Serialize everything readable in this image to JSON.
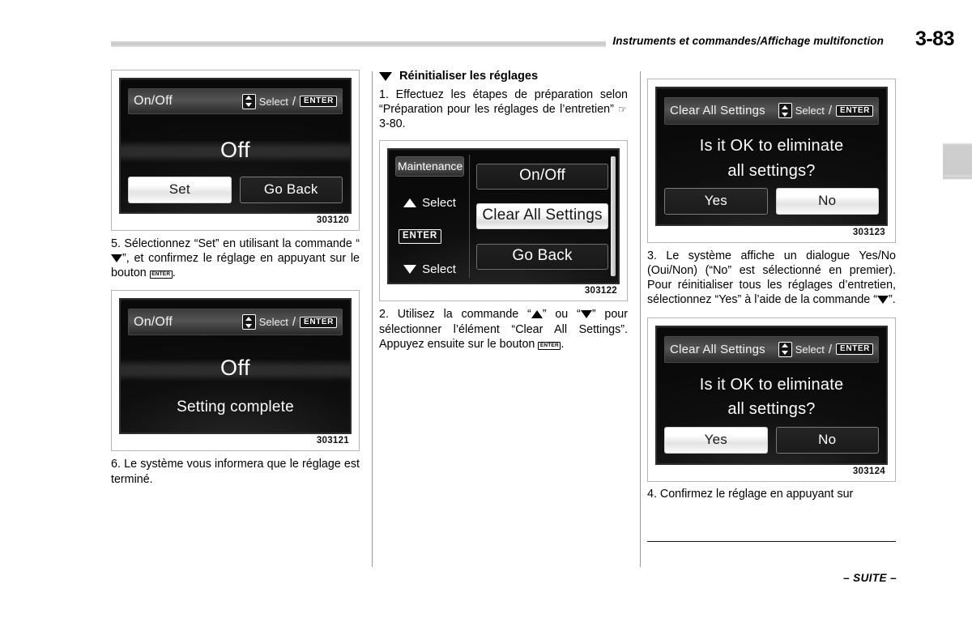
{
  "header": {
    "title": "Instruments et commandes/Affichage multifonction",
    "page_number": "3-83"
  },
  "footer": {
    "continued": "– SUITE –"
  },
  "columns": {
    "left": {
      "figures": [
        {
          "id": "303120",
          "screen": {
            "title": "On/Off",
            "select_label": "Select",
            "enter_label": "ENTER",
            "value": "Off",
            "buttons": [
              {
                "label": "Set",
                "selected": true
              },
              {
                "label": "Go Back",
                "selected": false
              }
            ]
          }
        },
        {
          "id": "303121",
          "screen": {
            "title": "On/Off",
            "select_label": "Select",
            "enter_label": "ENTER",
            "value": "Off",
            "message": "Setting complete"
          }
        }
      ],
      "steps": [
        {
          "text_a": "5. Sélectionnez “Set” en utilisant la commande “",
          "text_b": "”, et confirmez le réglage en appuyant sur le bouton ",
          "enter": "ENTER",
          "text_c": "."
        },
        {
          "text": "6. Le système vous informera que le réglage est terminé."
        }
      ]
    },
    "middle": {
      "section_heading": "Réinitialiser les réglages",
      "step1": {
        "text_a": "1. Effectuez les étapes de préparation selon “Préparation pour les réglages de l’entretien” ",
        "ref_icon": "☞",
        "ref": "3-80."
      },
      "figure": {
        "id": "303122",
        "screen": {
          "side": {
            "title": "Maintenance",
            "select_up": "Select",
            "enter_label": "ENTER",
            "select_down": "Select"
          },
          "items": [
            {
              "label": "On/Off",
              "selected": false
            },
            {
              "label": "Clear All Settings",
              "selected": true
            },
            {
              "label": "Go Back",
              "selected": false
            }
          ]
        }
      },
      "step2": {
        "text_a": "2. Utilisez la commande “",
        "text_b": "” ou “",
        "text_c": "” pour sélectionner l’élément “Clear All Settings”. Appuyez ensuite sur le bouton ",
        "enter": "ENTER",
        "text_d": "."
      }
    },
    "right": {
      "figures": [
        {
          "id": "303123",
          "screen": {
            "title": "Clear All Settings",
            "select_label": "Select",
            "enter_label": "ENTER",
            "line1": "Is it OK to eliminate",
            "line2": "all settings?",
            "buttons": [
              {
                "label": "Yes",
                "selected": false
              },
              {
                "label": "No",
                "selected": true
              }
            ]
          }
        },
        {
          "id": "303124",
          "screen": {
            "title": "Clear All Settings",
            "select_label": "Select",
            "enter_label": "ENTER",
            "line1": "Is it OK to eliminate",
            "line2": "all settings?",
            "buttons": [
              {
                "label": "Yes",
                "selected": true
              },
              {
                "label": "No",
                "selected": false
              }
            ]
          }
        }
      ],
      "step3": {
        "text_a": "3.  Le système affiche un dialogue Yes/No (Oui/Non) (“No” est sélectionné en premier). Pour réinitialiser tous les réglages d’entretien, sélectionnez “Yes” à l’aide de la commande “",
        "text_b": "”."
      },
      "step4": {
        "text": "4.  Confirmez le réglage en appuyant sur"
      }
    }
  }
}
